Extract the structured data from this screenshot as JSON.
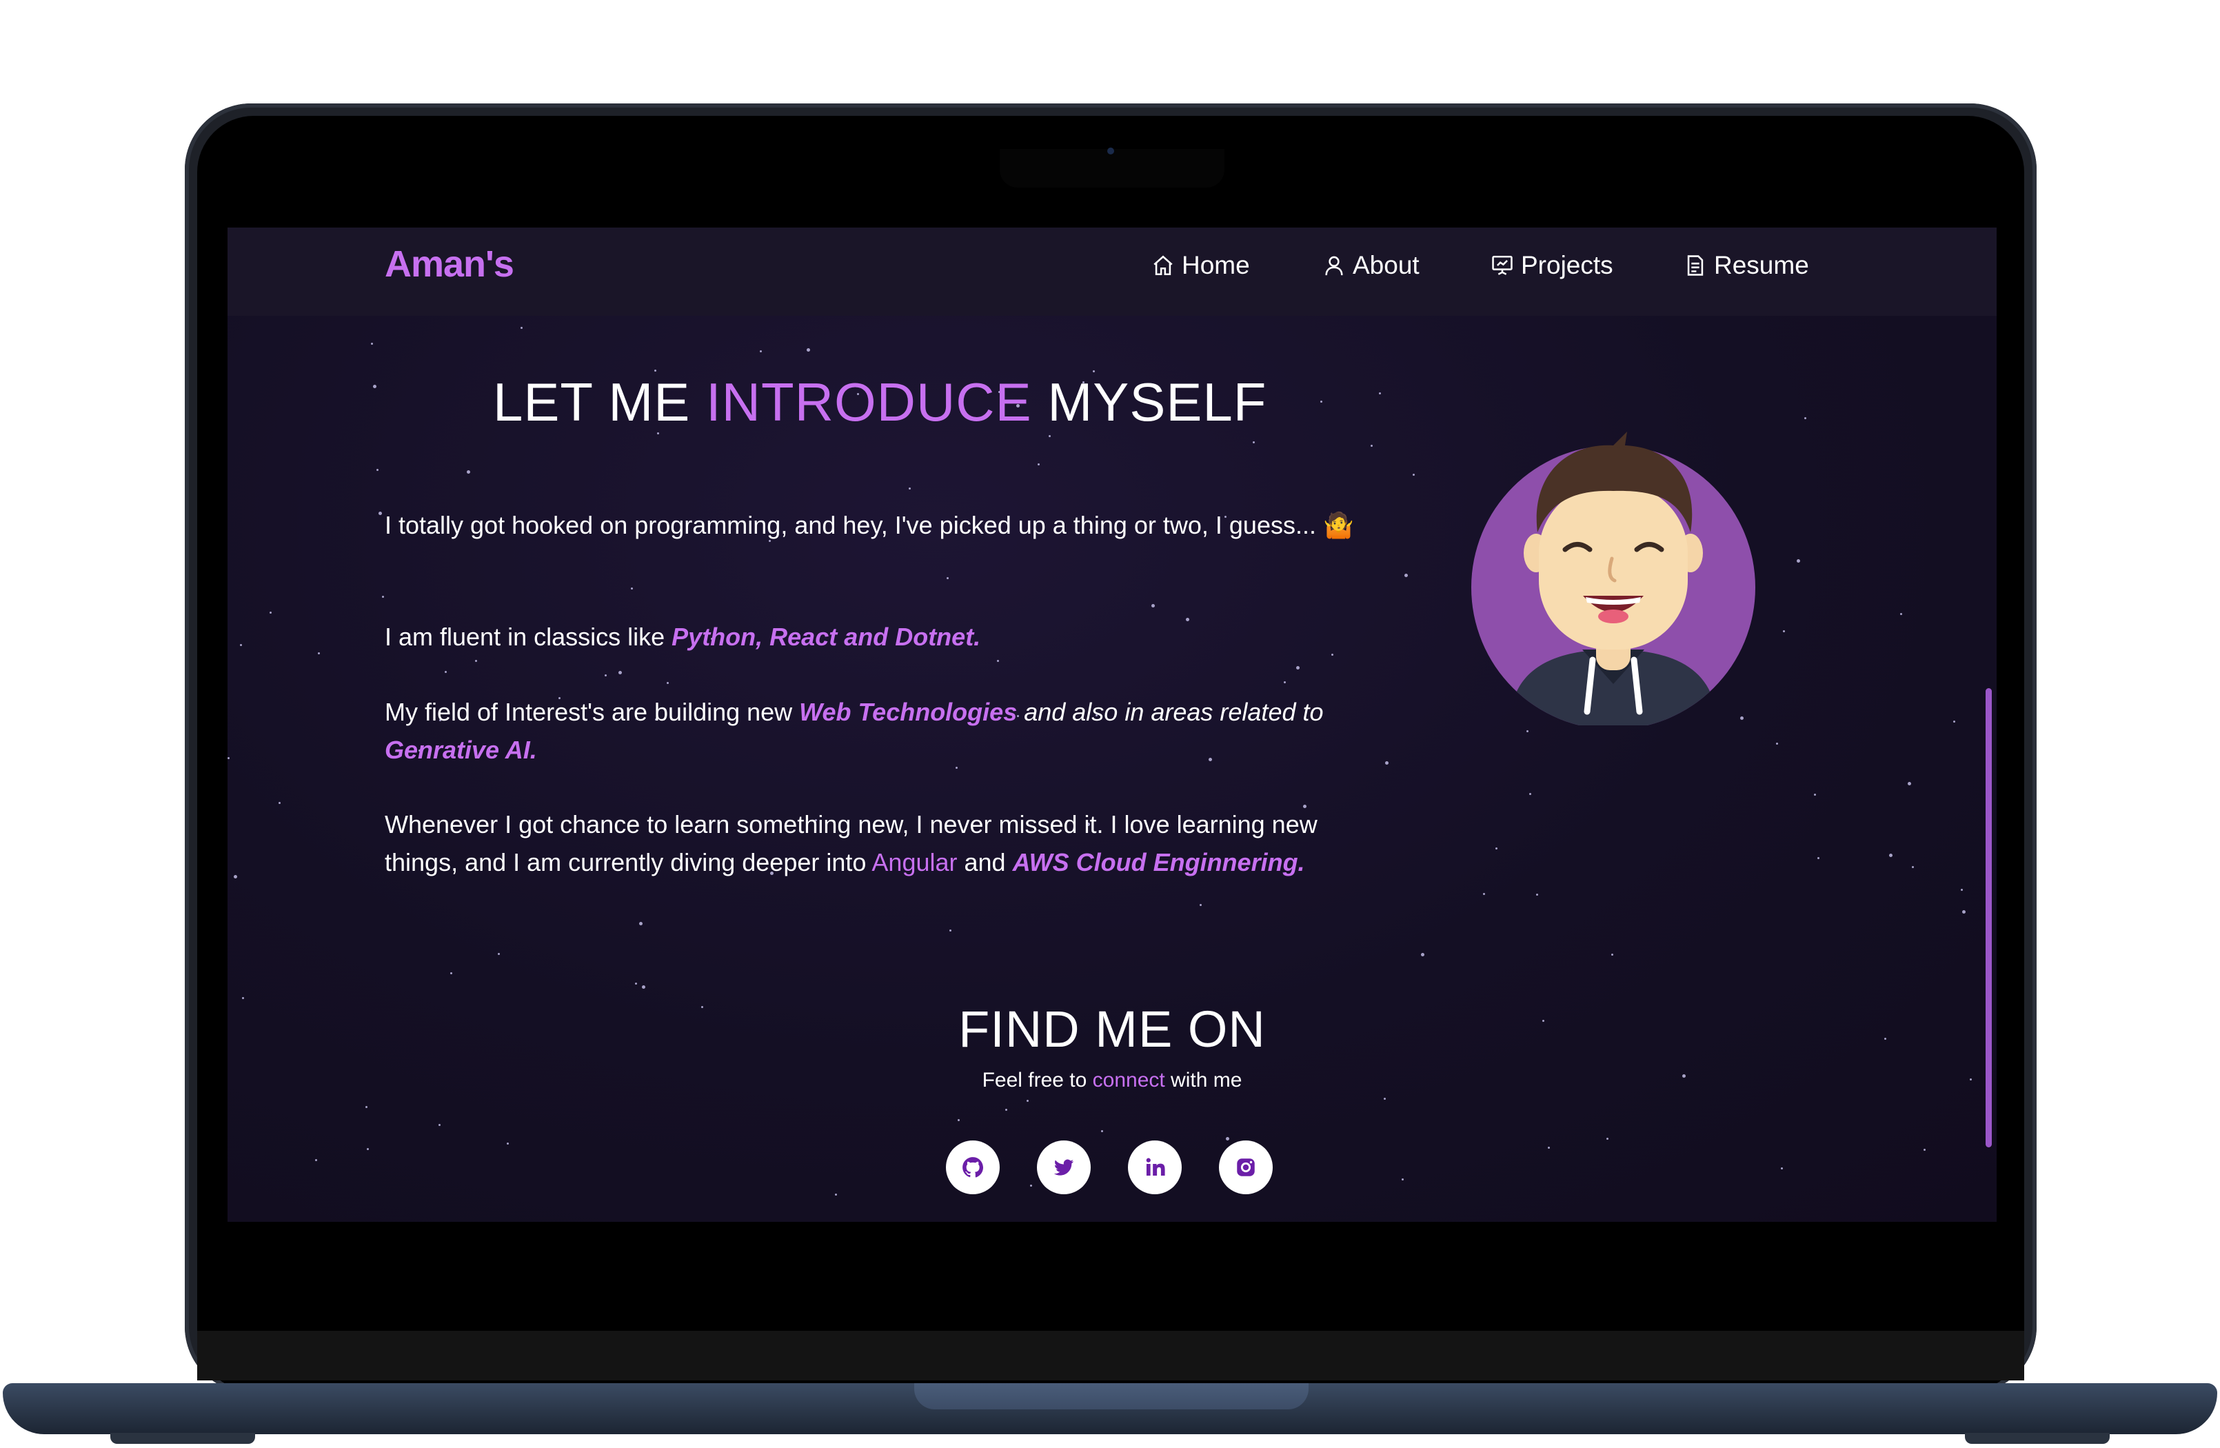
{
  "navbar": {
    "brand": "Aman's",
    "items": [
      {
        "label": "Home",
        "icon": "home-icon"
      },
      {
        "label": "About",
        "icon": "user-icon"
      },
      {
        "label": "Projects",
        "icon": "presentation-icon"
      },
      {
        "label": "Resume",
        "icon": "document-icon"
      }
    ]
  },
  "intro": {
    "title_prefix": "LET ME ",
    "title_highlight": "INTRODUCE",
    "title_suffix": " MYSELF",
    "p1_text": "I totally got hooked on programming, and hey, I've picked up a thing or two, I guess... 🤷",
    "p2_prefix": "I am fluent in classics like ",
    "p2_highlight": "Python, React and Dotnet.",
    "p3_prefix": "My field of Interest's are building new ",
    "p3_highlight1": "Web Technologies",
    "p3_middle": " and also in areas related to ",
    "p3_highlight2": "Genrative AI.",
    "p4_prefix": "Whenever I got chance to learn something new, I never missed it. I love learning new things, and I am currently diving deeper into ",
    "p4_highlight1": "Angular",
    "p4_and": " and ",
    "p4_highlight2": "AWS Cloud Enginnering."
  },
  "find": {
    "title": "FIND ME ON",
    "sub_prefix": "Feel free to ",
    "sub_link": "connect",
    "sub_suffix": " with me"
  },
  "social_links": [
    {
      "icon": "github-icon"
    },
    {
      "icon": "twitter-icon"
    },
    {
      "icon": "linkedin-icon"
    },
    {
      "icon": "instagram-icon"
    }
  ],
  "colors": {
    "accent": "#c770f0",
    "background": "#140f24",
    "navbar": "#1a1528",
    "avatar_circle": "#8e4fab"
  }
}
